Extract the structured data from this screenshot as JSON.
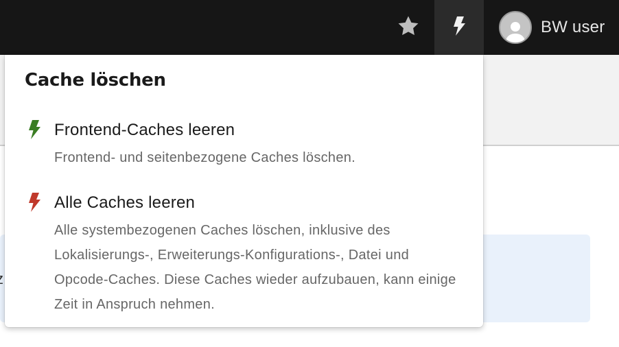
{
  "topbar": {
    "bookmark_icon": "star-icon",
    "cache_icon": "bolt-icon",
    "user": {
      "avatar_icon": "user-avatar-icon",
      "name": "BW user"
    }
  },
  "background": {
    "edge_text": "z"
  },
  "cache_menu": {
    "title": "Cache löschen",
    "items": [
      {
        "icon": "bolt-green-icon",
        "icon_color": "#3a7d23",
        "label": "Frontend-Caches leeren",
        "description": "Frontend- und seitenbezogene Caches löschen."
      },
      {
        "icon": "bolt-red-icon",
        "icon_color": "#c0392b",
        "label": "Alle Caches leeren",
        "description": "Alle systembezogenen Caches löschen, inklusive des Lokalisierungs-, Erweiterungs-Konfigurations-, Datei und Opcode-Caches. Diese Caches wieder aufzubauen, kann einige Zeit in Anspruch nehmen."
      }
    ]
  },
  "colors": {
    "topbar_bg": "#161616",
    "active_toolbar_item": "#2b2b2b",
    "info_box": "#e9f1fb"
  }
}
